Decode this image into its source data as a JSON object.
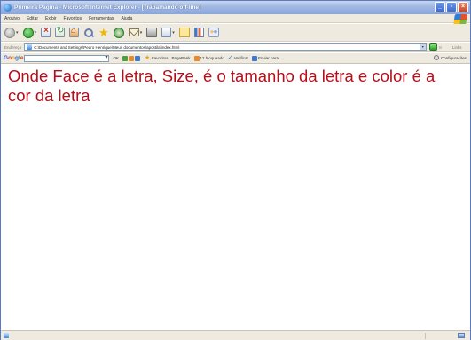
{
  "window": {
    "title": "Primeira Página - Microsoft Internet Explorer - [Trabalhando off-line]",
    "minimize_label": "_",
    "maximize_label": "▫",
    "close_label": "×"
  },
  "menubar": {
    "items": [
      "Arquivo",
      "Editar",
      "Exibir",
      "Favoritos",
      "Ferramentas",
      "Ajuda"
    ]
  },
  "addressbar": {
    "label": "Endereço",
    "url": "C:\\Documents and Settings\\Pedro Henrique\\Meus documentos\\apostila\\index.html",
    "go_label": "Ir",
    "links_label": "Links"
  },
  "googlebar": {
    "logo": "Google",
    "items": {
      "search": "OK",
      "favorites": "Favoritos",
      "pagerank": "PageRank",
      "blocked": "12 bloqueado",
      "check": "Verificar",
      "send": "Enviar para",
      "settings": "Configurações"
    }
  },
  "content": {
    "text": "Onde Face é a letra, Size, é o tamanho da letra e color é a cor da letra",
    "text_color": "#b3101c"
  },
  "colors": {
    "chrome": "#eeeae0",
    "title_gradient": "#8aa6da"
  }
}
